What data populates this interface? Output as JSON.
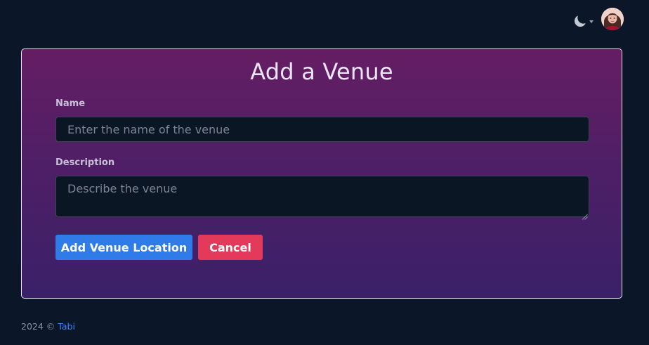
{
  "header": {
    "theme_toggle_icon": "moon-icon",
    "avatar_icon": "user-avatar"
  },
  "form": {
    "title": "Add a Venue",
    "name_label": "Name",
    "name_placeholder": "Enter the name of the venue",
    "name_value": "",
    "description_label": "Description",
    "description_placeholder": "Describe the venue",
    "description_value": "",
    "submit_label": "Add Venue Location",
    "cancel_label": "Cancel"
  },
  "footer": {
    "copyright": "2024 ©",
    "brand_link": "Tabi"
  },
  "colors": {
    "background": "#0b1728",
    "card_gradient_top": "#651d63",
    "card_gradient_bottom": "#3a2068",
    "primary_button": "#2f7be8",
    "danger_button": "#e33a5b",
    "link": "#3b82f6"
  }
}
